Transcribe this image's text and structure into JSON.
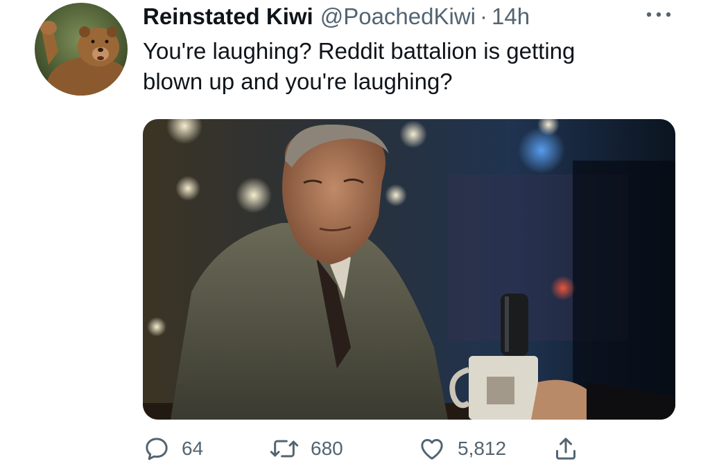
{
  "tweet": {
    "author": {
      "display_name": "Reinstated Kiwi",
      "handle": "@PoachedKiwi",
      "separator": "·",
      "time": "14h",
      "avatar_icon": "bear-avatar-icon"
    },
    "text_line_1": "You're laughing? Reddit battalion is getting",
    "text_line_2": "blown up and you're laughing?",
    "media_alt": "Man in a tweed suit at a table with a microphone and a mug",
    "actions": {
      "reply_count": "64",
      "retweet_count": "680",
      "like_count": "5,812"
    }
  },
  "colors": {
    "text_primary": "#0f1419",
    "text_secondary": "#536471"
  }
}
